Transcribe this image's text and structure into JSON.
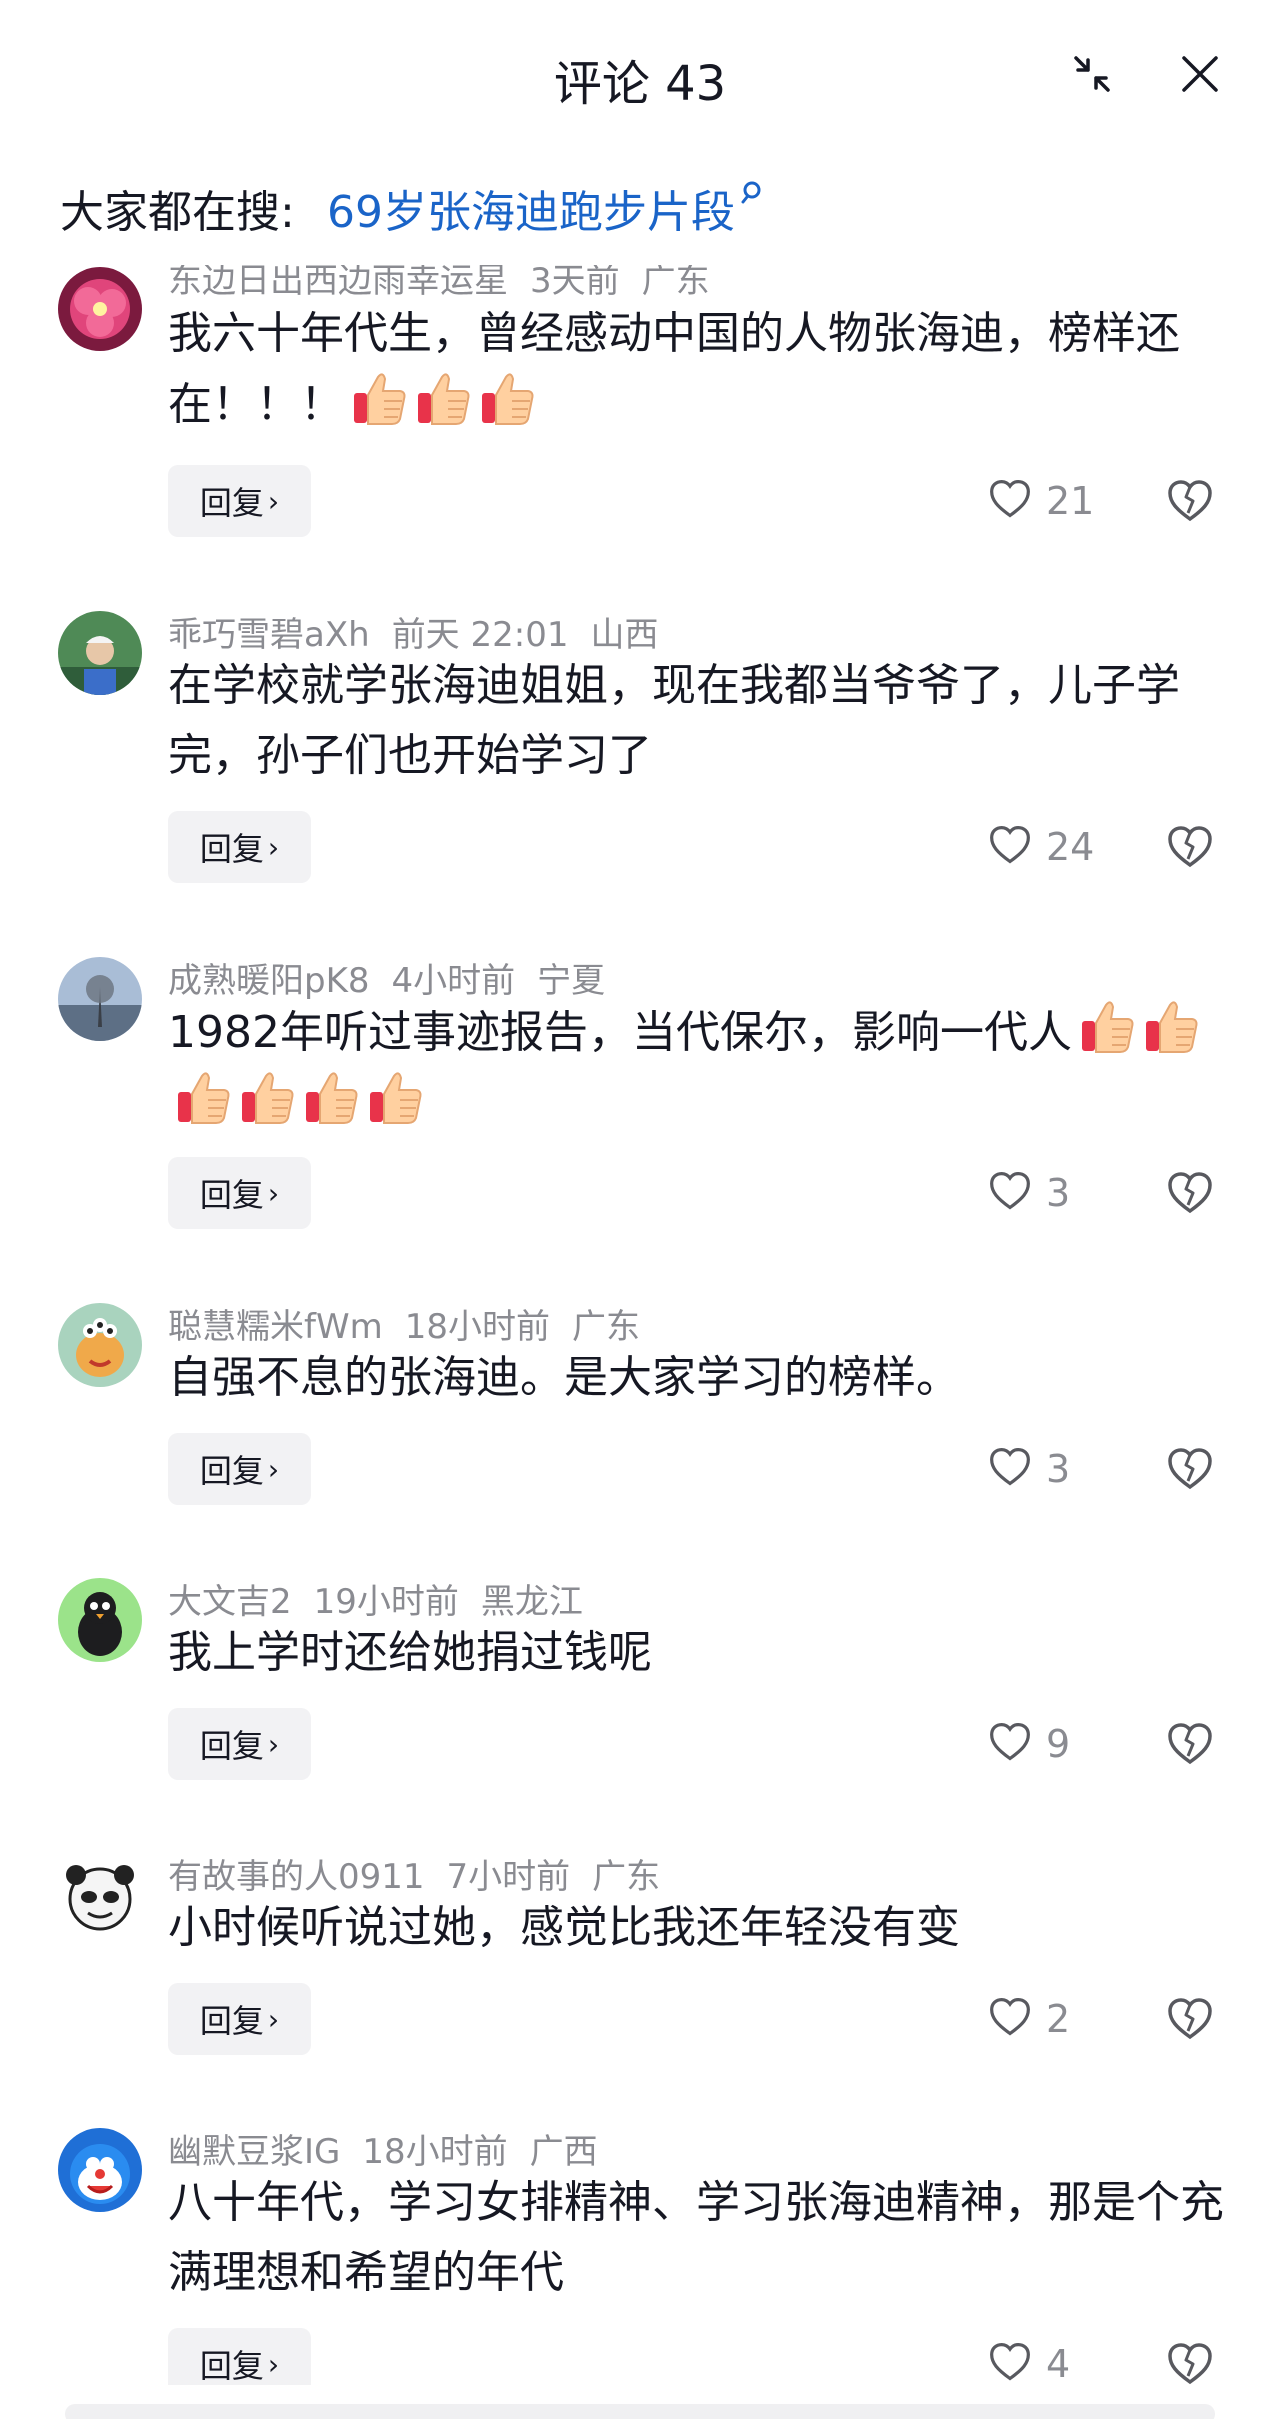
{
  "header": {
    "title": "评论 43",
    "collapse_icon": "collapse-icon",
    "close_icon": "close-icon"
  },
  "search": {
    "prefix": "大家都在搜:",
    "query": "69岁张海迪跑步片段",
    "icon": "search-icon"
  },
  "reply_label": "回复",
  "comments": [
    {
      "user": "东边日出西边雨幸运星",
      "time": "3天前",
      "location": "广东",
      "text": "我六十年代生，曾经感动中国的人物张海迪，榜样还在！！！",
      "thumbs": 3,
      "likes": "21"
    },
    {
      "user": "乖巧雪碧aXh",
      "time": "前天 22:01",
      "location": "山西",
      "text": "在学校就学张海迪姐姐，现在我都当爷爷了，儿子学完，孙子们也开始学习了",
      "thumbs": 0,
      "likes": "24"
    },
    {
      "user": "成熟暖阳pK8",
      "time": "4小时前",
      "location": "宁夏",
      "text": "1982年听过事迹报告，当代保尔，影响一代人",
      "thumbs": 6,
      "likes": "3"
    },
    {
      "user": "聪慧糯米fWm",
      "time": "18小时前",
      "location": "广东",
      "text": "自强不息的张海迪。是大家学习的榜样。",
      "thumbs": 0,
      "likes": "3"
    },
    {
      "user": "大文吉2",
      "time": "19小时前",
      "location": "黑龙江",
      "text": "我上学时还给她捐过钱呢",
      "thumbs": 0,
      "likes": "9"
    },
    {
      "user": "有故事的人0911",
      "time": "7小时前",
      "location": "广东",
      "text": "小时候听说过她，感觉比我还年轻没有变",
      "thumbs": 0,
      "likes": "2"
    },
    {
      "user": "幽默豆浆IG",
      "time": "18小时前",
      "location": "广西",
      "text": "八十年代，学习女排精神、学习张海迪精神，那是个充满理想和希望的年代",
      "thumbs": 0,
      "likes": "4"
    }
  ],
  "colors": {
    "link": "#1a64c8",
    "meta": "#8a8b91",
    "text": "#161823",
    "reply_bg": "#f2f2f4"
  }
}
